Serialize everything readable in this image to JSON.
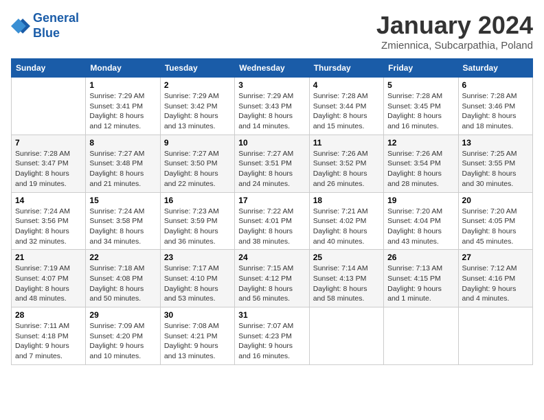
{
  "logo": {
    "line1": "General",
    "line2": "Blue"
  },
  "title": "January 2024",
  "location": "Zmiennica, Subcarpathia, Poland",
  "headers": [
    "Sunday",
    "Monday",
    "Tuesday",
    "Wednesday",
    "Thursday",
    "Friday",
    "Saturday"
  ],
  "weeks": [
    [
      {
        "day": "",
        "sunrise": "",
        "sunset": "",
        "daylight": ""
      },
      {
        "day": "1",
        "sunrise": "Sunrise: 7:29 AM",
        "sunset": "Sunset: 3:41 PM",
        "daylight": "Daylight: 8 hours and 12 minutes."
      },
      {
        "day": "2",
        "sunrise": "Sunrise: 7:29 AM",
        "sunset": "Sunset: 3:42 PM",
        "daylight": "Daylight: 8 hours and 13 minutes."
      },
      {
        "day": "3",
        "sunrise": "Sunrise: 7:29 AM",
        "sunset": "Sunset: 3:43 PM",
        "daylight": "Daylight: 8 hours and 14 minutes."
      },
      {
        "day": "4",
        "sunrise": "Sunrise: 7:28 AM",
        "sunset": "Sunset: 3:44 PM",
        "daylight": "Daylight: 8 hours and 15 minutes."
      },
      {
        "day": "5",
        "sunrise": "Sunrise: 7:28 AM",
        "sunset": "Sunset: 3:45 PM",
        "daylight": "Daylight: 8 hours and 16 minutes."
      },
      {
        "day": "6",
        "sunrise": "Sunrise: 7:28 AM",
        "sunset": "Sunset: 3:46 PM",
        "daylight": "Daylight: 8 hours and 18 minutes."
      }
    ],
    [
      {
        "day": "7",
        "sunrise": "Sunrise: 7:28 AM",
        "sunset": "Sunset: 3:47 PM",
        "daylight": "Daylight: 8 hours and 19 minutes."
      },
      {
        "day": "8",
        "sunrise": "Sunrise: 7:27 AM",
        "sunset": "Sunset: 3:48 PM",
        "daylight": "Daylight: 8 hours and 21 minutes."
      },
      {
        "day": "9",
        "sunrise": "Sunrise: 7:27 AM",
        "sunset": "Sunset: 3:50 PM",
        "daylight": "Daylight: 8 hours and 22 minutes."
      },
      {
        "day": "10",
        "sunrise": "Sunrise: 7:27 AM",
        "sunset": "Sunset: 3:51 PM",
        "daylight": "Daylight: 8 hours and 24 minutes."
      },
      {
        "day": "11",
        "sunrise": "Sunrise: 7:26 AM",
        "sunset": "Sunset: 3:52 PM",
        "daylight": "Daylight: 8 hours and 26 minutes."
      },
      {
        "day": "12",
        "sunrise": "Sunrise: 7:26 AM",
        "sunset": "Sunset: 3:54 PM",
        "daylight": "Daylight: 8 hours and 28 minutes."
      },
      {
        "day": "13",
        "sunrise": "Sunrise: 7:25 AM",
        "sunset": "Sunset: 3:55 PM",
        "daylight": "Daylight: 8 hours and 30 minutes."
      }
    ],
    [
      {
        "day": "14",
        "sunrise": "Sunrise: 7:24 AM",
        "sunset": "Sunset: 3:56 PM",
        "daylight": "Daylight: 8 hours and 32 minutes."
      },
      {
        "day": "15",
        "sunrise": "Sunrise: 7:24 AM",
        "sunset": "Sunset: 3:58 PM",
        "daylight": "Daylight: 8 hours and 34 minutes."
      },
      {
        "day": "16",
        "sunrise": "Sunrise: 7:23 AM",
        "sunset": "Sunset: 3:59 PM",
        "daylight": "Daylight: 8 hours and 36 minutes."
      },
      {
        "day": "17",
        "sunrise": "Sunrise: 7:22 AM",
        "sunset": "Sunset: 4:01 PM",
        "daylight": "Daylight: 8 hours and 38 minutes."
      },
      {
        "day": "18",
        "sunrise": "Sunrise: 7:21 AM",
        "sunset": "Sunset: 4:02 PM",
        "daylight": "Daylight: 8 hours and 40 minutes."
      },
      {
        "day": "19",
        "sunrise": "Sunrise: 7:20 AM",
        "sunset": "Sunset: 4:04 PM",
        "daylight": "Daylight: 8 hours and 43 minutes."
      },
      {
        "day": "20",
        "sunrise": "Sunrise: 7:20 AM",
        "sunset": "Sunset: 4:05 PM",
        "daylight": "Daylight: 8 hours and 45 minutes."
      }
    ],
    [
      {
        "day": "21",
        "sunrise": "Sunrise: 7:19 AM",
        "sunset": "Sunset: 4:07 PM",
        "daylight": "Daylight: 8 hours and 48 minutes."
      },
      {
        "day": "22",
        "sunrise": "Sunrise: 7:18 AM",
        "sunset": "Sunset: 4:08 PM",
        "daylight": "Daylight: 8 hours and 50 minutes."
      },
      {
        "day": "23",
        "sunrise": "Sunrise: 7:17 AM",
        "sunset": "Sunset: 4:10 PM",
        "daylight": "Daylight: 8 hours and 53 minutes."
      },
      {
        "day": "24",
        "sunrise": "Sunrise: 7:15 AM",
        "sunset": "Sunset: 4:12 PM",
        "daylight": "Daylight: 8 hours and 56 minutes."
      },
      {
        "day": "25",
        "sunrise": "Sunrise: 7:14 AM",
        "sunset": "Sunset: 4:13 PM",
        "daylight": "Daylight: 8 hours and 58 minutes."
      },
      {
        "day": "26",
        "sunrise": "Sunrise: 7:13 AM",
        "sunset": "Sunset: 4:15 PM",
        "daylight": "Daylight: 9 hours and 1 minute."
      },
      {
        "day": "27",
        "sunrise": "Sunrise: 7:12 AM",
        "sunset": "Sunset: 4:16 PM",
        "daylight": "Daylight: 9 hours and 4 minutes."
      }
    ],
    [
      {
        "day": "28",
        "sunrise": "Sunrise: 7:11 AM",
        "sunset": "Sunset: 4:18 PM",
        "daylight": "Daylight: 9 hours and 7 minutes."
      },
      {
        "day": "29",
        "sunrise": "Sunrise: 7:09 AM",
        "sunset": "Sunset: 4:20 PM",
        "daylight": "Daylight: 9 hours and 10 minutes."
      },
      {
        "day": "30",
        "sunrise": "Sunrise: 7:08 AM",
        "sunset": "Sunset: 4:21 PM",
        "daylight": "Daylight: 9 hours and 13 minutes."
      },
      {
        "day": "31",
        "sunrise": "Sunrise: 7:07 AM",
        "sunset": "Sunset: 4:23 PM",
        "daylight": "Daylight: 9 hours and 16 minutes."
      },
      {
        "day": "",
        "sunrise": "",
        "sunset": "",
        "daylight": ""
      },
      {
        "day": "",
        "sunrise": "",
        "sunset": "",
        "daylight": ""
      },
      {
        "day": "",
        "sunrise": "",
        "sunset": "",
        "daylight": ""
      }
    ]
  ]
}
